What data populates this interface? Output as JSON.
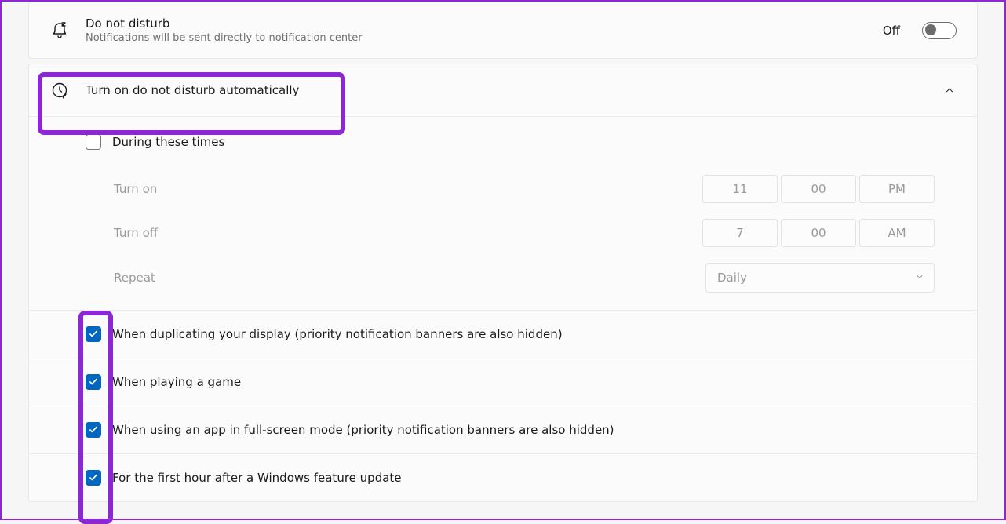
{
  "dnd": {
    "title": "Do not disturb",
    "subtitle": "Notifications will be sent directly to notification center",
    "state_label": "Off"
  },
  "auto": {
    "header": "Turn on do not disturb automatically",
    "during_times": {
      "label": "During these times",
      "checked": false,
      "turn_on_label": "Turn on",
      "turn_on": {
        "hh": "11",
        "mm": "00",
        "ampm": "PM"
      },
      "turn_off_label": "Turn off",
      "turn_off": {
        "hh": "7",
        "mm": "00",
        "ampm": "AM"
      },
      "repeat_label": "Repeat",
      "repeat_value": "Daily"
    },
    "rules": [
      {
        "checked": true,
        "label": "When duplicating your display (priority notification banners are also hidden)"
      },
      {
        "checked": true,
        "label": "When playing a game"
      },
      {
        "checked": true,
        "label": "When using an app in full-screen mode (priority notification banners are also hidden)"
      },
      {
        "checked": true,
        "label": "For the first hour after a Windows feature update"
      }
    ]
  }
}
